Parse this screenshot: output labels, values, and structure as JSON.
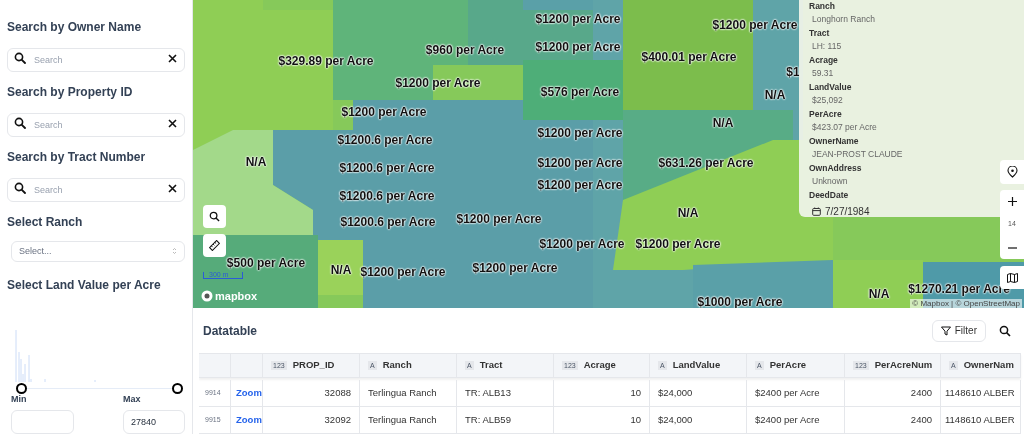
{
  "sidebar": {
    "search_fields": [
      {
        "label": "Search by Owner Name",
        "placeholder": "Search"
      },
      {
        "label": "Search by Property ID",
        "placeholder": "Search"
      },
      {
        "label": "Search by Tract Number",
        "placeholder": "Search"
      }
    ],
    "ranch_select": {
      "label": "Select Ranch",
      "placeholder": "Select..."
    },
    "land_value": {
      "label": "Select Land Value per Acre",
      "thumbs": [
        {
          "level": 0
        },
        {
          "level": 1
        }
      ],
      "min": {
        "label": "Min"
      },
      "max": {
        "label": "Max",
        "value": "27840"
      }
    }
  },
  "map": {
    "labels": [
      "$329.89 per Acre",
      "$960 per Acre",
      "$1200 per Acre",
      "$1200 per Acre",
      "$1200 per Acre",
      "$1200 per Acre",
      "$576 per Acre",
      "$400.01 per Acre",
      "$1200 per Acre",
      "$1",
      "N/A",
      "N/A",
      "$1200 per Acre",
      "$1200.6 per Acre",
      "N/A",
      "$1200.6 per Acre",
      "$1200 per Acre",
      "$631.26 per Acre",
      "$1200 per Acre",
      "$1200.6 per Acre",
      "N/A",
      "$1200.6 per Acre",
      "$1200 per Acre",
      "$1200 per Acre",
      "$1200 per Acre",
      "$500 per Acre",
      "N/A",
      "$1200 per Acre",
      "$1200 per Acre",
      "$1000 per Acre",
      "N/A",
      "$1270.21 per Acre"
    ],
    "scale": "300 m",
    "logo": "mapbox",
    "attribution": "© Mapbox | © OpenStreetMap",
    "zoom_level": "14",
    "popup": [
      {
        "kind": "text",
        "label": "Ranch",
        "value": "Longhorn Ranch"
      },
      {
        "kind": "text",
        "label": "Tract",
        "value": "LH: 115"
      },
      {
        "kind": "text",
        "label": "Acrage",
        "value": "59.31"
      },
      {
        "kind": "text",
        "label": "LandValue",
        "value": "$25,092"
      },
      {
        "kind": "text",
        "label": "PerAcre",
        "value": "$423.07 per Acre"
      },
      {
        "kind": "text",
        "label": "OwnerName",
        "value": "JEAN-PROST CLAUDE"
      },
      {
        "kind": "text",
        "label": "OwnAddress",
        "value": "Unknown"
      },
      {
        "kind": "date",
        "label": "DeedDate",
        "value": "7/27/1984"
      }
    ]
  },
  "datatable": {
    "title": "Datatable",
    "filter_button": "Filter",
    "columns": [
      {
        "type": "123",
        "name": "PROP_ID"
      },
      {
        "type": "A",
        "name": "Ranch"
      },
      {
        "type": "A",
        "name": "Tract"
      },
      {
        "type": "123",
        "name": "Acrage"
      },
      {
        "type": "A",
        "name": "LandValue"
      },
      {
        "type": "A",
        "name": "PerAcre"
      },
      {
        "type": "123",
        "name": "PerAcreNum"
      },
      {
        "type": "A",
        "name": "OwnerNam"
      }
    ],
    "rows": [
      {
        "index": "9914",
        "link": "Zoom",
        "cells": [
          "32088",
          "Terlingua Ranch",
          "TR: ALB13",
          "10",
          "$24,000",
          "$2400 per Acre",
          "2400",
          "1148610 ALBER"
        ]
      },
      {
        "index": "9915",
        "link": "Zoom",
        "cells": [
          "32092",
          "Terlingua Ranch",
          "TR: ALB59",
          "10",
          "$24,000",
          "$2400 per Acre",
          "2400",
          "1148610 ALBER"
        ]
      }
    ]
  }
}
